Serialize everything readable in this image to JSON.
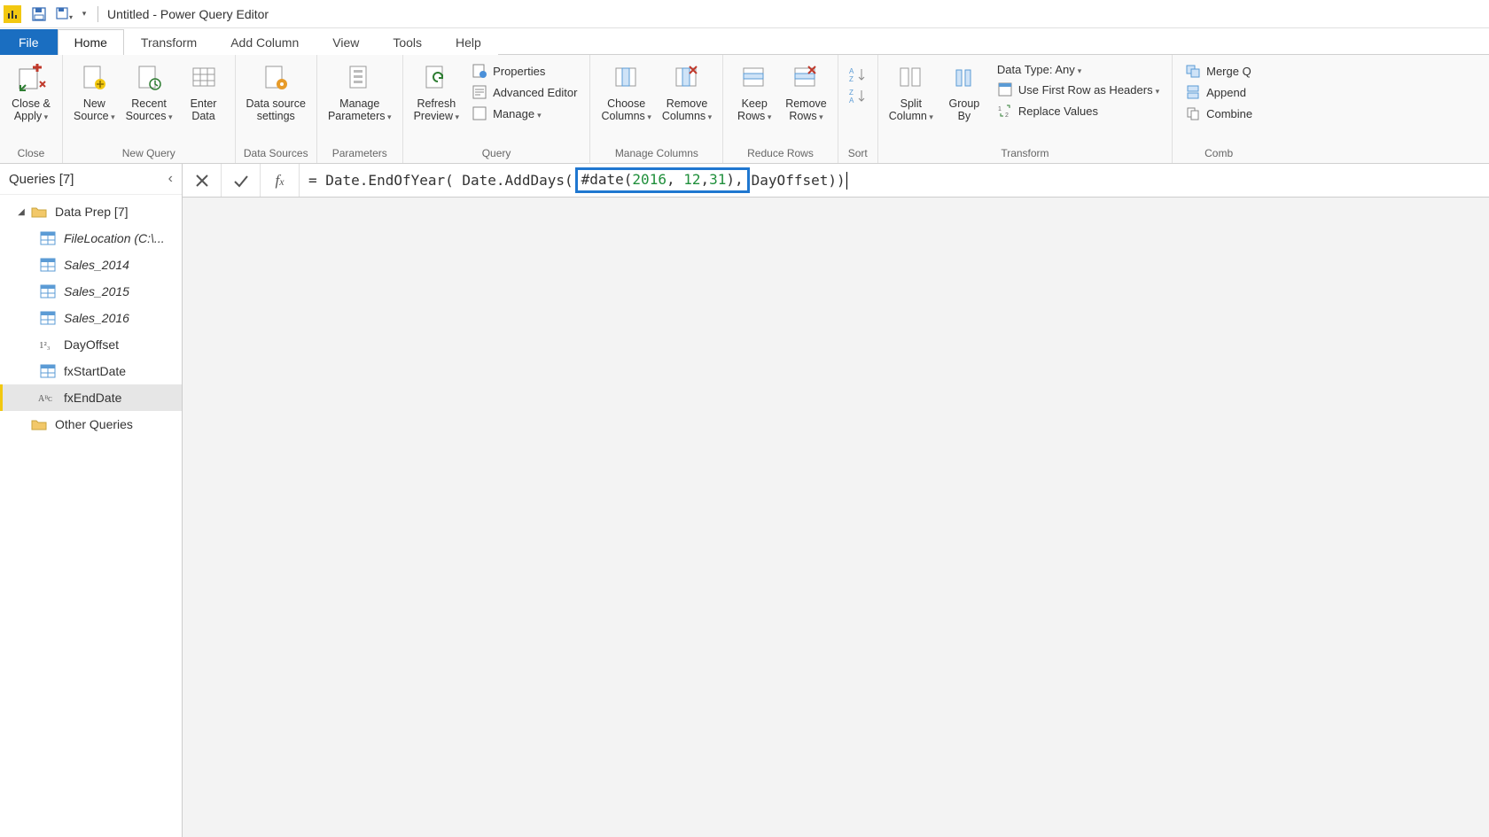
{
  "title": "Untitled - Power Query Editor",
  "tabs": {
    "file": "File",
    "home": "Home",
    "transform": "Transform",
    "addcol": "Add Column",
    "view": "View",
    "tools": "Tools",
    "help": "Help"
  },
  "ribbon": {
    "close": {
      "closeApply": "Close &\nApply",
      "group": "Close"
    },
    "newQuery": {
      "newSource": "New\nSource",
      "recentSources": "Recent\nSources",
      "enterData": "Enter\nData",
      "group": "New Query"
    },
    "dataSources": {
      "settings": "Data source\nsettings",
      "group": "Data Sources"
    },
    "parameters": {
      "manage": "Manage\nParameters",
      "group": "Parameters"
    },
    "query": {
      "refresh": "Refresh\nPreview",
      "properties": "Properties",
      "advEditor": "Advanced Editor",
      "manage": "Manage",
      "group": "Query"
    },
    "manageColumns": {
      "choose": "Choose\nColumns",
      "remove": "Remove\nColumns",
      "group": "Manage Columns"
    },
    "reduceRows": {
      "keep": "Keep\nRows",
      "remove": "Remove\nRows",
      "group": "Reduce Rows"
    },
    "sort": {
      "group": "Sort"
    },
    "transform": {
      "split": "Split\nColumn",
      "group": "Group\nBy",
      "dataType": "Data Type: Any",
      "firstRow": "Use First Row as Headers",
      "replace": "Replace Values",
      "groupLabel": "Transform"
    },
    "combine": {
      "merge": "Merge Q",
      "append": "Append",
      "combine": "Combine",
      "group": "Comb"
    }
  },
  "queriesPane": {
    "header": "Queries [7]",
    "group": "Data Prep [7]",
    "items": [
      {
        "label": "FileLocation (C:\\...",
        "icon": "table",
        "italic": true
      },
      {
        "label": "Sales_2014",
        "icon": "table",
        "italic": true
      },
      {
        "label": "Sales_2015",
        "icon": "table",
        "italic": true
      },
      {
        "label": "Sales_2016",
        "icon": "table",
        "italic": true
      },
      {
        "label": "DayOffset",
        "icon": "num",
        "italic": false
      },
      {
        "label": "fxStartDate",
        "icon": "table",
        "italic": false
      },
      {
        "label": "fxEndDate",
        "icon": "abc",
        "italic": false,
        "selected": true
      }
    ],
    "other": "Other Queries"
  },
  "formula": {
    "pre": "= Date.EndOfYear( Date.AddDays(",
    "hlPre": "#date(",
    "n1": "2016",
    "c1": ", ",
    "n2": "12",
    "c2": ",",
    "n3": "31",
    "hlPost": "),",
    "post": " DayOffset))"
  }
}
